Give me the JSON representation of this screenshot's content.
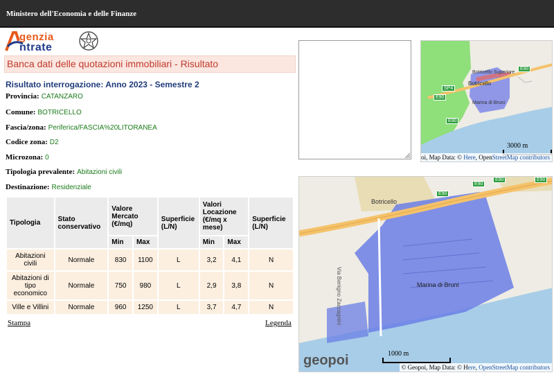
{
  "header": {
    "title": "Ministero dell'Economia e delle Finanze"
  },
  "logo": {
    "line1": "genzia",
    "line2": "ntrate"
  },
  "page": {
    "title": "Banca dati delle quotazioni immobiliari - Risultato"
  },
  "result": {
    "heading": "Risultato interrogazione: Anno 2023 - Semestre 2",
    "fields": [
      {
        "label": "Provincia:",
        "value": "CATANZARO"
      },
      {
        "label": "Comune:",
        "value": "BOTRICELLO"
      },
      {
        "label": "Fascia/zona:",
        "value": "Periferica/FASCIA%20LITORANEA"
      },
      {
        "label": "Codice zona:",
        "value": "D2"
      },
      {
        "label": "Microzona:",
        "value": "0"
      },
      {
        "label": "Tipologia prevalente:",
        "value": "Abitazioni civili"
      },
      {
        "label": "Destinazione:",
        "value": "Residenziale"
      }
    ]
  },
  "table": {
    "headers": {
      "tipologia": "Tipologia",
      "stato": "Stato conservativo",
      "valore_mercato": "Valore Mercato (€/mq)",
      "superficie1": "Superficie (L/N)",
      "valori_locazione": "Valori Locazione (€/mq x mese)",
      "superficie2": "Superficie (L/N)",
      "min": "Min",
      "max": "Max"
    },
    "rows": [
      {
        "tipologia": "Abitazioni civili",
        "stato": "Normale",
        "vm_min": "830",
        "vm_max": "1100",
        "sup1": "L",
        "vl_min": "3,2",
        "vl_max": "4,1",
        "sup2": "N"
      },
      {
        "tipologia": "Abitazioni di tipo economico",
        "stato": "Normale",
        "vm_min": "750",
        "vm_max": "980",
        "sup1": "L",
        "vl_min": "2,9",
        "vl_max": "3,8",
        "sup2": "N"
      },
      {
        "tipologia": "Ville e Villini",
        "stato": "Normale",
        "vm_min": "960",
        "vm_max": "1250",
        "sup1": "L",
        "vl_min": "3,7",
        "vl_max": "4,7",
        "sup2": "N"
      }
    ]
  },
  "links": {
    "stampa": "Stampa",
    "legenda": "Legenda"
  },
  "note_box": {
    "value": ""
  },
  "map_small": {
    "labels": {
      "town": "Botricello",
      "superiore": "Botricello Superiore",
      "marina": "Marina di Bruni"
    },
    "shields": [
      "E90",
      "SP4",
      "E90",
      "E90"
    ],
    "scale": "3000 m",
    "attribution_prefix": "© Geopoi, Map Data: ©",
    "attribution_here": "Here",
    "attribution_sep": ", Open",
    "attribution_osm": "StreetMap contributors"
  },
  "map_large": {
    "labels": {
      "town": "Botricello",
      "street": "Via Benigno Zaccagnini",
      "marina": "Marina di Bruni"
    },
    "shields": [
      "E90",
      "E90",
      "E90",
      "E90"
    ],
    "scale": "1000 m",
    "brand": "geopoi",
    "attribution_prefix": "© Geopoi, Map Data: © H",
    "attribution_here": "ere",
    "attribution_sep": ", ",
    "attribution_osm": "OpenStreetMap contributors"
  },
  "colors": {
    "header_bg": "#2d2d2d",
    "title_bg": "#fbe6e0",
    "title_text": "#c0392b",
    "heading_text": "#1f3b7a",
    "value_text": "#1a7a1a",
    "table_header_bg": "#ebebeb",
    "table_cell_bg": "#fcefe0",
    "zone_fill": "#6b7fe6",
    "sea": "#a8cde8",
    "park": "#8fdf7a"
  }
}
